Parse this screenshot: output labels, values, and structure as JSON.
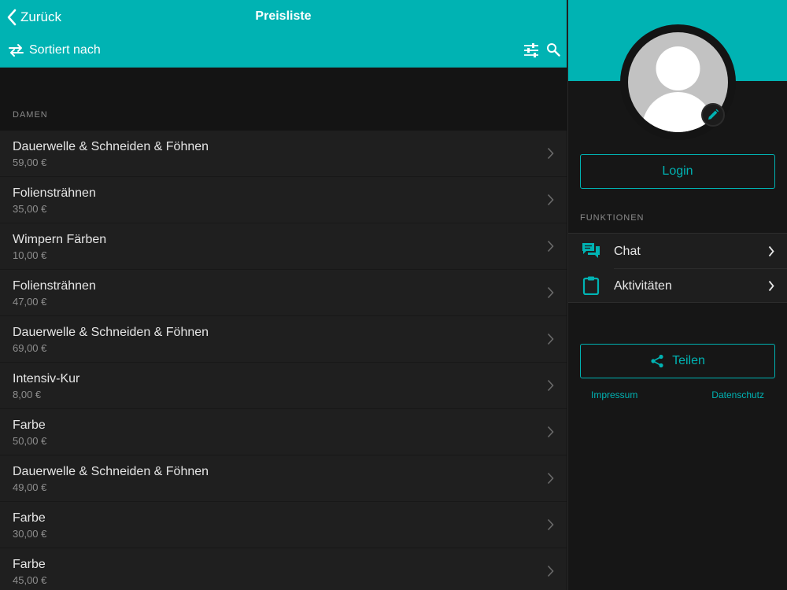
{
  "colors": {
    "accent": "#00b3b3",
    "background": "#141414",
    "row": "#1f1f1f",
    "text": "#e6e6e6",
    "muted": "#8e8e8e"
  },
  "header": {
    "back_label": "Zurück",
    "title": "Preisliste",
    "sort_label": "Sortiert nach",
    "icons": {
      "back": "chevron-left-icon",
      "sort": "swap-icon",
      "filter": "sliders-icon",
      "search": "search-icon"
    }
  },
  "section": {
    "label": "DAMEN"
  },
  "items": [
    {
      "name": "Dauerwelle & Schneiden & Föhnen",
      "price": "59,00 €"
    },
    {
      "name": "Foliensträhnen",
      "price": "35,00 €"
    },
    {
      "name": "Wimpern Färben",
      "price": "10,00 €"
    },
    {
      "name": "Foliensträhnen",
      "price": "47,00 €"
    },
    {
      "name": "Dauerwelle & Schneiden & Föhnen",
      "price": "69,00 €"
    },
    {
      "name": "Intensiv-Kur",
      "price": "8,00 €"
    },
    {
      "name": "Farbe",
      "price": "50,00 €"
    },
    {
      "name": "Dauerwelle & Schneiden & Föhnen",
      "price": "49,00 €"
    },
    {
      "name": "Farbe",
      "price": "30,00 €"
    },
    {
      "name": "Farbe",
      "price": "45,00 €"
    }
  ],
  "sidebar": {
    "login_label": "Login",
    "functions_label": "FUNKTIONEN",
    "functions": [
      {
        "label": "Chat",
        "icon": "chat-icon"
      },
      {
        "label": "Aktivitäten",
        "icon": "clipboard-icon"
      }
    ],
    "share_label": "Teilen",
    "impressum_label": "Impressum",
    "datenschutz_label": "Datenschutz"
  }
}
